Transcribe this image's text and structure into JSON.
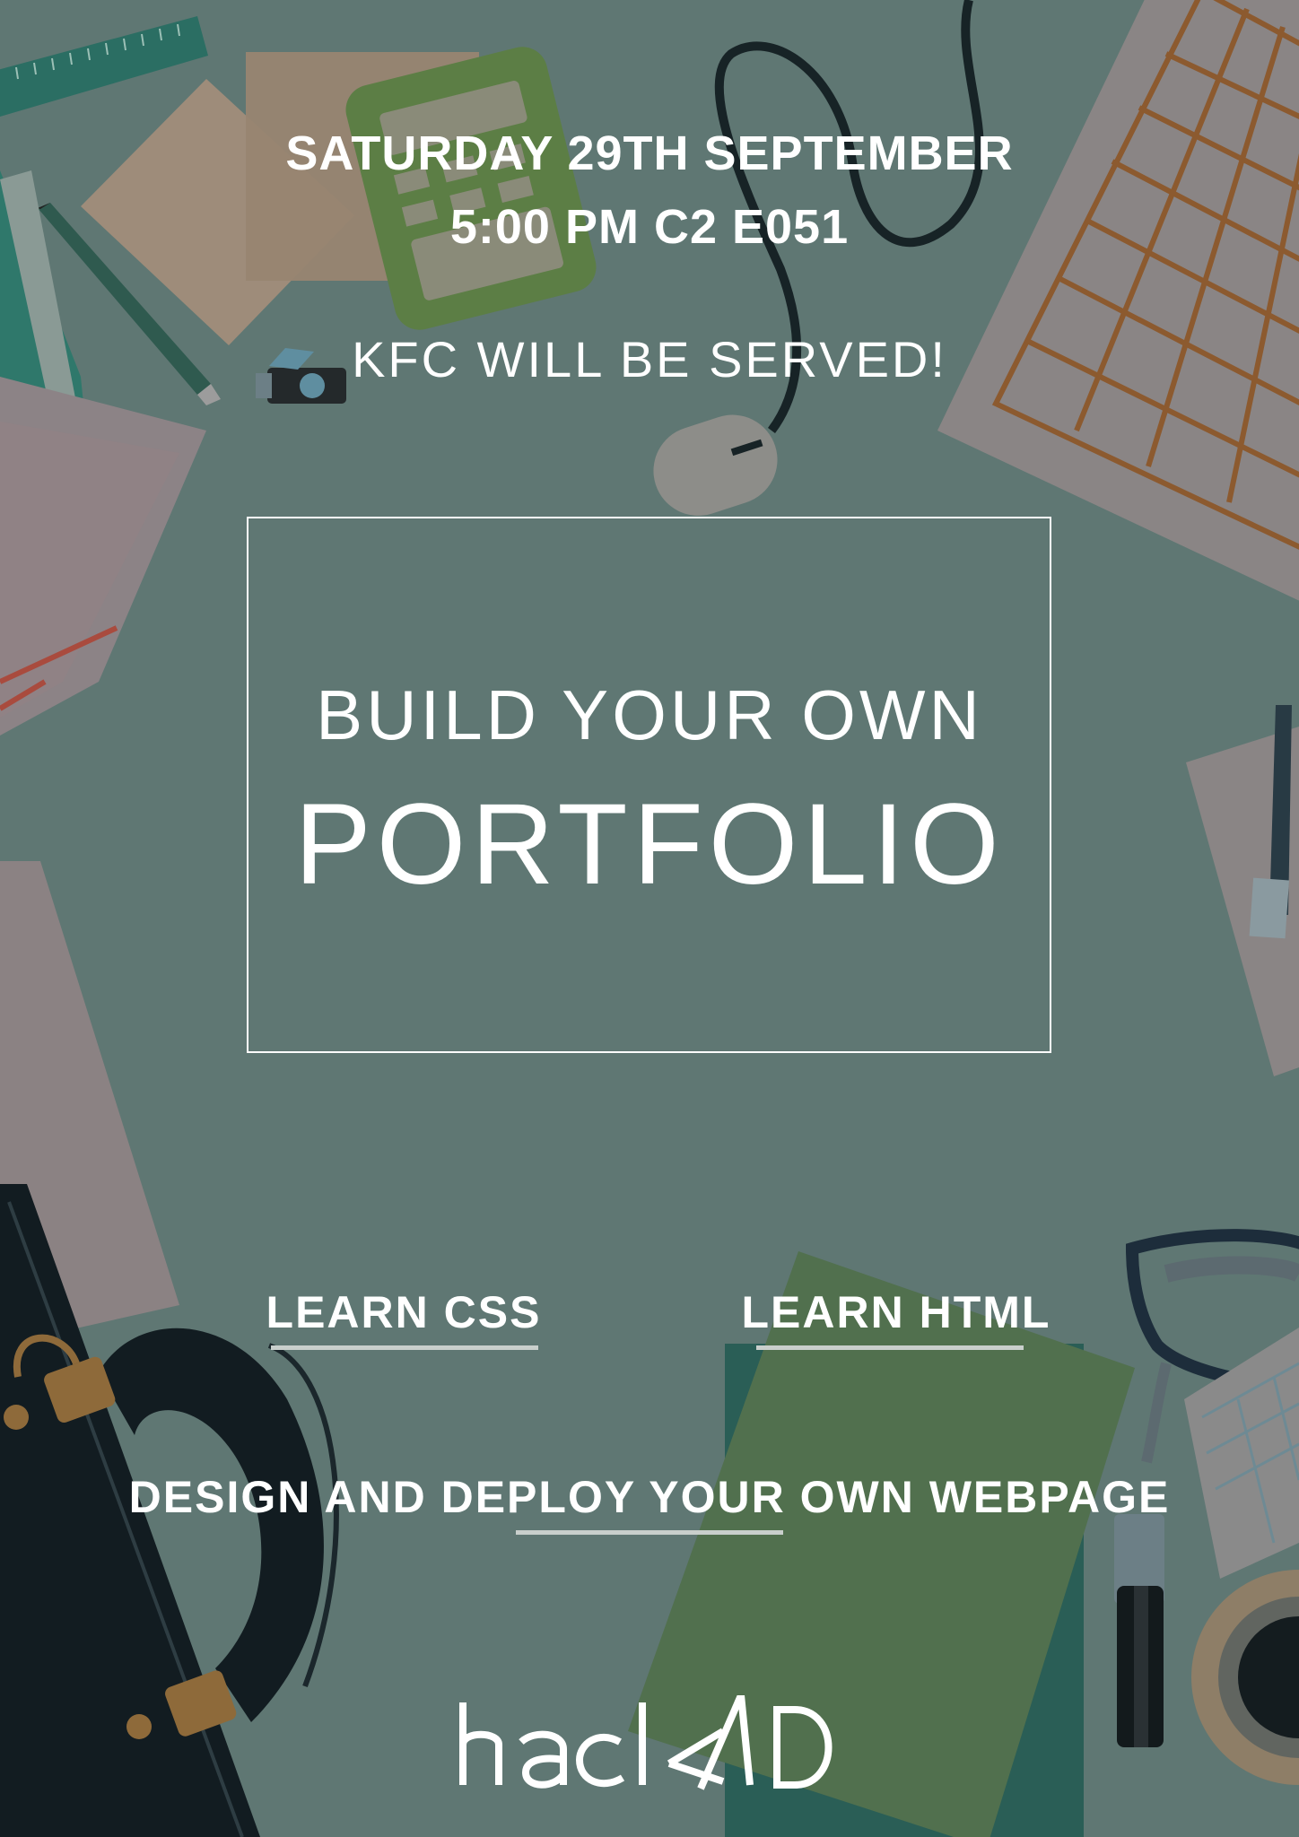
{
  "event": {
    "date": "SATURDAY 29TH SEPTEMBER",
    "time_location": "5:00 PM C2 E051",
    "food_note": "KFC WILL BE SERVED!"
  },
  "headline": {
    "line1": "BUILD YOUR OWN",
    "line2": "PORTFOLIO"
  },
  "topics": [
    {
      "label": "LEARN CSS"
    },
    {
      "label": "LEARN HTML"
    }
  ],
  "tagline": "DESIGN AND DEPLOY YOUR OWN WEBPAGE",
  "logo": {
    "text": "hackAD"
  },
  "colors": {
    "background": "#5f7773",
    "text": "#ffffff",
    "underline": "#c9cfcc"
  },
  "background_icons": [
    "ruler-icon",
    "sticky-note-icon",
    "calculator-icon",
    "pencil-icon",
    "usb-drive-icon",
    "computer-mouse-icon",
    "keyboard-icon",
    "notebook-icon",
    "pen-icon",
    "briefcase-icon",
    "folder-icon",
    "glasses-icon",
    "marker-icon",
    "coffee-cup-icon"
  ]
}
